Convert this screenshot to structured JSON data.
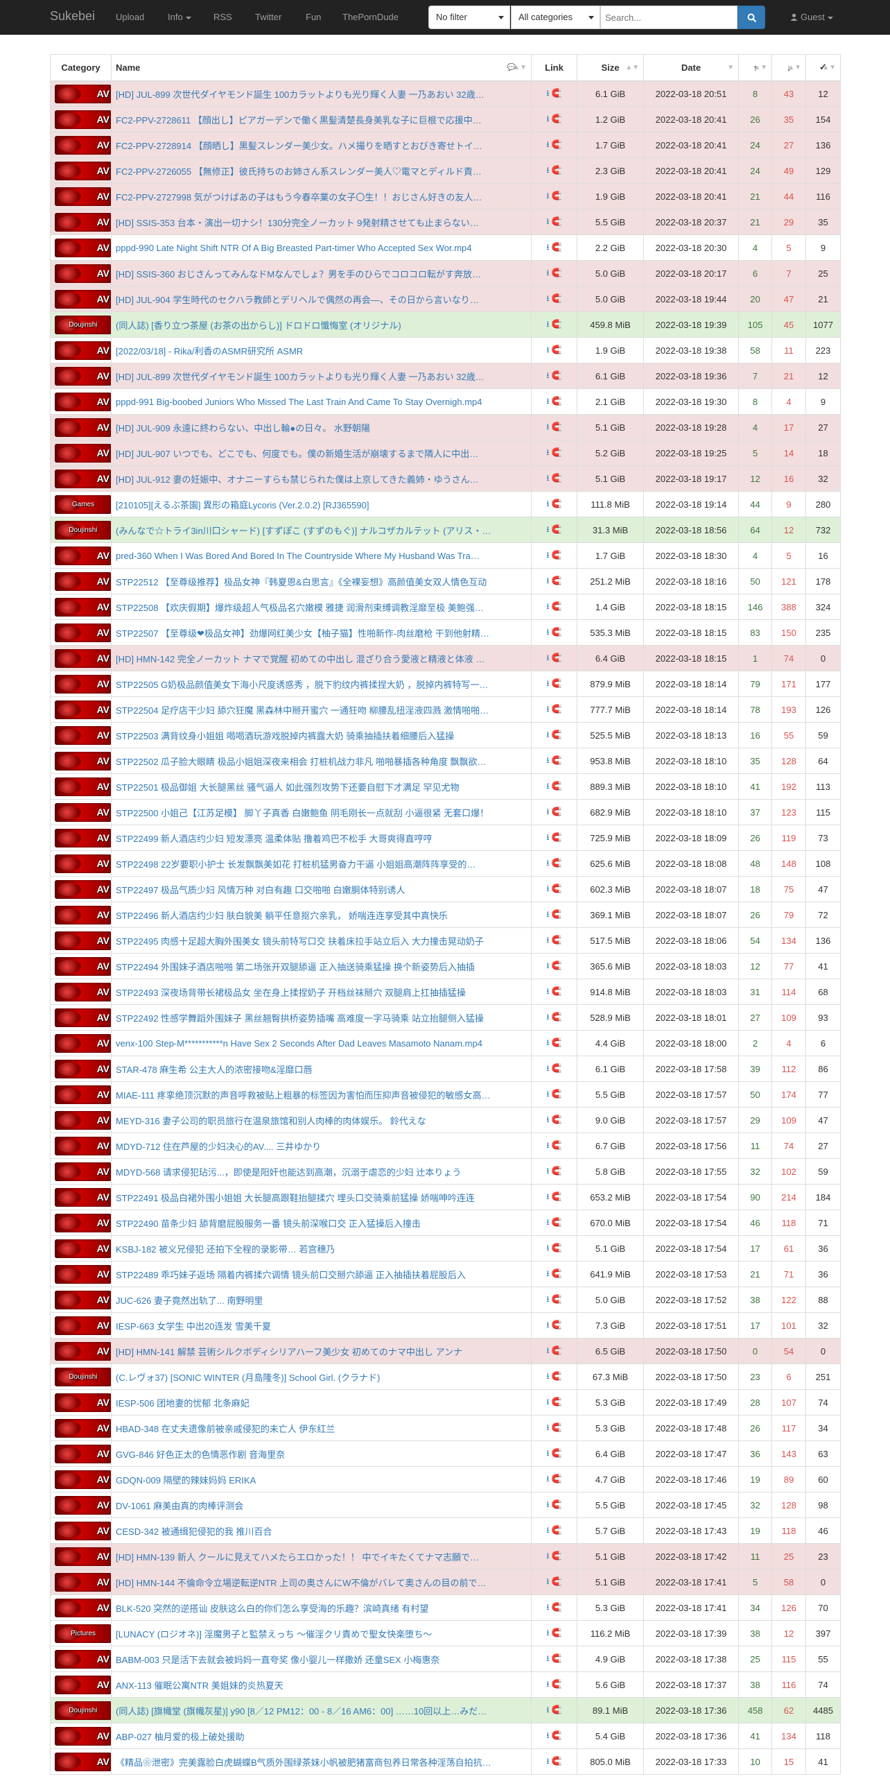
{
  "navbar": {
    "brand": "Sukebei",
    "links": [
      "Upload",
      "Info",
      "RSS",
      "Twitter",
      "Fun",
      "ThePornDude"
    ],
    "filter": "No filter",
    "category": "All categories",
    "search_placeholder": "Search...",
    "user": "Guest"
  },
  "table": {
    "headers": [
      "Category",
      "Name",
      "Link",
      "Size",
      "Date",
      "↑",
      "↓",
      "✓"
    ],
    "rows": [
      {
        "cat": "AV",
        "name": "[HD] JUL-899 次世代ダイヤモンド誕生 100カラットよりも光り輝く人妻 一乃あおい 32歳…",
        "size": "6.1 GiB",
        "date": "2022-03-18 20:51",
        "seed": "8",
        "leech": "43",
        "dl": "12",
        "style": "danger"
      },
      {
        "cat": "AV",
        "name": "FC2-PPV-2728611 【顔出し】ピアガーデンで働く黒髪清楚長身美乳な子に巨根で応援中…",
        "size": "1.2 GiB",
        "date": "2022-03-18 20:41",
        "seed": "26",
        "leech": "35",
        "dl": "154",
        "style": "danger"
      },
      {
        "cat": "AV",
        "name": "FC2-PPV-2728914 【顔晒し】黒髪スレンダー美少女。ハメ撮りを晒すとおびき寄せトイ…",
        "size": "1.7 GiB",
        "date": "2022-03-18 20:41",
        "seed": "24",
        "leech": "27",
        "dl": "136",
        "style": "danger"
      },
      {
        "cat": "AV",
        "name": "FC2-PPV-2726055 【無修正】彼氏持ちのお姉さん系スレンダー美人♡電マとディルド責…",
        "size": "2.3 GiB",
        "date": "2022-03-18 20:41",
        "seed": "24",
        "leech": "49",
        "dl": "129",
        "style": "danger"
      },
      {
        "cat": "AV",
        "name": "FC2-PPV-2727998 気がつけばあの子はもう今春卒業の女子〇生！！おじさん好きの友人…",
        "size": "1.9 GiB",
        "date": "2022-03-18 20:41",
        "seed": "21",
        "leech": "44",
        "dl": "116",
        "style": "danger"
      },
      {
        "cat": "AV",
        "name": "[HD] SSIS-353 台本・演出一切ナシ！130分完全ノーカット 9発射精させても止まらない…",
        "size": "5.5 GiB",
        "date": "2022-03-18 20:37",
        "seed": "21",
        "leech": "29",
        "dl": "35",
        "style": "danger"
      },
      {
        "cat": "AV",
        "name": "pppd-990 Late Night Shift NTR Of A Big Breasted Part-timer Who Accepted Sex Wor.mp4",
        "size": "2.2 GiB",
        "date": "2022-03-18 20:30",
        "seed": "4",
        "leech": "5",
        "dl": "9",
        "style": ""
      },
      {
        "cat": "AV",
        "name": "[HD] SSIS-360 おじさんってみんなドMなんでしょ？男を手のひらでコロコロ転がす奔放…",
        "size": "5.0 GiB",
        "date": "2022-03-18 20:17",
        "seed": "6",
        "leech": "7",
        "dl": "25",
        "style": "danger"
      },
      {
        "cat": "AV",
        "name": "[HD] JUL-904 学生時代のセクハラ教師とデリヘルで偶然の再会—、その日から言いなり…",
        "size": "5.0 GiB",
        "date": "2022-03-18 19:44",
        "seed": "20",
        "leech": "47",
        "dl": "21",
        "style": "danger"
      },
      {
        "cat": "Doujinshi",
        "name": "(同人誌) [香り立つ茶屋 (お茶の出からし)] ドロドロ懺悔室 (オリジナル)",
        "size": "459.8 MiB",
        "date": "2022-03-18 19:39",
        "seed": "105",
        "leech": "45",
        "dl": "1077",
        "style": "success"
      },
      {
        "cat": "AV",
        "name": "[2022/03/18] - Rika/利香のASMR研究所 ASMR",
        "size": "1.9 GiB",
        "date": "2022-03-18 19:38",
        "seed": "58",
        "leech": "11",
        "dl": "223",
        "style": ""
      },
      {
        "cat": "AV",
        "name": "[HD] JUL-899 次世代ダイヤモンド誕生 100カラットよりも光り輝く人妻 一乃あおい 32歳…",
        "size": "6.1 GiB",
        "date": "2022-03-18 19:36",
        "seed": "7",
        "leech": "21",
        "dl": "12",
        "style": "danger"
      },
      {
        "cat": "AV",
        "name": "pppd-991 Big-boobed Juniors Who Missed The Last Train And Came To Stay Overnigh.mp4",
        "size": "2.1 GiB",
        "date": "2022-03-18 19:30",
        "seed": "8",
        "leech": "4",
        "dl": "9",
        "style": ""
      },
      {
        "cat": "AV",
        "name": "[HD] JUL-909 永遠に終わらない、中出し輪●の日々。 水野朝陽",
        "size": "5.1 GiB",
        "date": "2022-03-18 19:28",
        "seed": "4",
        "leech": "17",
        "dl": "27",
        "style": "danger"
      },
      {
        "cat": "AV",
        "name": "[HD] JUL-907 いつでも、どこでも、何度でも。僕の新婚生活が崩壊するまで隣人に中出…",
        "size": "5.2 GiB",
        "date": "2022-03-18 19:25",
        "seed": "5",
        "leech": "14",
        "dl": "18",
        "style": "danger"
      },
      {
        "cat": "AV",
        "name": "[HD] JUL-912 妻の妊娠中、オナニーすらも禁じられた僕は上京してきた義姉・ゆうさん…",
        "size": "5.1 GiB",
        "date": "2022-03-18 19:17",
        "seed": "12",
        "leech": "16",
        "dl": "32",
        "style": "danger"
      },
      {
        "cat": "Games",
        "name": "[210105][えるぶ茶園] 異形の箱庭Lycoris (Ver.2.0.2) [RJ365590]",
        "size": "111.8 MiB",
        "date": "2022-03-18 19:14",
        "seed": "44",
        "leech": "9",
        "dl": "280",
        "style": ""
      },
      {
        "cat": "Doujinshi",
        "name": "(みんなで☆トライ3in川口シャード) [すずぽこ (すずのもぐ)] ナルコザカルテット (アリス・…",
        "size": "31.3 MiB",
        "date": "2022-03-18 18:56",
        "seed": "64",
        "leech": "12",
        "dl": "732",
        "style": "success"
      },
      {
        "cat": "AV",
        "name": "pred-360 When I Was Bored And Bored In The Countryside Where My Husband Was Tra…",
        "size": "1.7 GiB",
        "date": "2022-03-18 18:30",
        "seed": "4",
        "leech": "5",
        "dl": "16",
        "style": ""
      },
      {
        "cat": "AV",
        "name": "STP22512 【至尊级推荐】极品女神『韩夏恩&白思言』《全裸妄想》高颜值美女双人情色互动",
        "size": "251.2 MiB",
        "date": "2022-03-18 18:16",
        "seed": "50",
        "leech": "121",
        "dl": "178",
        "style": ""
      },
      {
        "cat": "AV",
        "name": "STP22508 【欢庆假期】爆炸级超人气极品名穴嫩模 雅捷 润滑剂束缚调教淫靡至极 美鲍强…",
        "size": "1.4 GiB",
        "date": "2022-03-18 18:15",
        "seed": "146",
        "leech": "388",
        "dl": "324",
        "style": ""
      },
      {
        "cat": "AV",
        "name": "STP22507 【至尊级❤极品女神】劲爆网红美少女【柚子猫】性啪新作-肉丝磨枪 干到他射精…",
        "size": "535.3 MiB",
        "date": "2022-03-18 18:15",
        "seed": "83",
        "leech": "150",
        "dl": "235",
        "style": ""
      },
      {
        "cat": "AV",
        "name": "[HD] HMN-142 完全ノーカット ナマで覚醒 初めての中出し 混ざり合う愛液と精液と体液 …",
        "size": "6.4 GiB",
        "date": "2022-03-18 18:15",
        "seed": "1",
        "leech": "74",
        "dl": "0",
        "style": "danger"
      },
      {
        "cat": "AV",
        "name": "STP22505 G奶极品颜值美女下海小尺度诱惑秀 ，脱下豹纹内裤揉捏大奶 ，脱掉内裤特写一…",
        "size": "879.9 MiB",
        "date": "2022-03-18 18:14",
        "seed": "79",
        "leech": "171",
        "dl": "177",
        "style": ""
      },
      {
        "cat": "AV",
        "name": "STP22504 足疗店干少妇 舔穴狂魔 黑森林中掰开蜜穴 一通狂吻 柳腰乱扭淫液四溅 激情啪啪…",
        "size": "777.7 MiB",
        "date": "2022-03-18 18:14",
        "seed": "78",
        "leech": "193",
        "dl": "126",
        "style": ""
      },
      {
        "cat": "AV",
        "name": "STP22503 满背纹身小姐姐 喝喝酒玩游戏脱掉内裤露大奶 骑乘抽插扶着细腰后入猛操",
        "size": "525.5 MiB",
        "date": "2022-03-18 18:13",
        "seed": "16",
        "leech": "55",
        "dl": "59",
        "style": ""
      },
      {
        "cat": "AV",
        "name": "STP22502 瓜子脸大眼睛 极品小姐姐深夜来相会 打桩机战力非凡 啪啪暴插各种角度 飘飘欲…",
        "size": "953.8 MiB",
        "date": "2022-03-18 18:10",
        "seed": "35",
        "leech": "128",
        "dl": "64",
        "style": ""
      },
      {
        "cat": "AV",
        "name": "STP22501 极品御姐 大长腿黑丝 骚气逼人 如此强烈攻势下还要自慰下才满足 罕见尤物",
        "size": "889.3 MiB",
        "date": "2022-03-18 18:10",
        "seed": "41",
        "leech": "192",
        "dl": "113",
        "style": ""
      },
      {
        "cat": "AV",
        "name": "STP22500 小姐己【江苏足模】 脚丫子真香 白嫩鲍鱼 阴毛刚长一点就刮 小逼很紧 无套口爆！",
        "size": "682.9 MiB",
        "date": "2022-03-18 18:10",
        "seed": "37",
        "leech": "123",
        "dl": "115",
        "style": ""
      },
      {
        "cat": "AV",
        "name": "STP22499 新人酒店约少妇 短发漂亮 温柔体贴 撸着鸡巴不松手 大哥爽得直哼哼",
        "size": "725.9 MiB",
        "date": "2022-03-18 18:09",
        "seed": "26",
        "leech": "119",
        "dl": "73",
        "style": ""
      },
      {
        "cat": "AV",
        "name": "STP22498 22岁要职小护士 长发飘飘美如花 打桩机猛男奋力干逼 小姐姐高潮阵阵享受的…",
        "size": "625.6 MiB",
        "date": "2022-03-18 18:08",
        "seed": "48",
        "leech": "148",
        "dl": "108",
        "style": ""
      },
      {
        "cat": "AV",
        "name": "STP22497 极品气质少妇 风情万种 对白有趣 口交啪啪 白嫩胴体特别诱人",
        "size": "602.3 MiB",
        "date": "2022-03-18 18:07",
        "seed": "18",
        "leech": "75",
        "dl": "47",
        "style": ""
      },
      {
        "cat": "AV",
        "name": "STP22496 新人酒店约少妇 肤白貌美 躺平任意抠穴亲乳， 娇喘连连享受其中真快乐",
        "size": "369.1 MiB",
        "date": "2022-03-18 18:07",
        "seed": "26",
        "leech": "79",
        "dl": "72",
        "style": ""
      },
      {
        "cat": "AV",
        "name": "STP22495 肉感十足超大胸外围美女 镜头前特写口交 扶着床拉手站立后入 大力撞击晃动奶子",
        "size": "517.5 MiB",
        "date": "2022-03-18 18:06",
        "seed": "54",
        "leech": "134",
        "dl": "136",
        "style": ""
      },
      {
        "cat": "AV",
        "name": "STP22494 外围妹子酒店啪啪 第二场张开双腿舔逼 正入抽送骑乘猛操 换个新姿势后入抽插",
        "size": "365.6 MiB",
        "date": "2022-03-18 18:03",
        "seed": "12",
        "leech": "77",
        "dl": "41",
        "style": ""
      },
      {
        "cat": "AV",
        "name": "STP22493 深夜场背带长裙极品女 坐在身上揉捏奶子 开档丝袜掰穴 双腿肩上扛抽插猛操",
        "size": "914.8 MiB",
        "date": "2022-03-18 18:03",
        "seed": "31",
        "leech": "114",
        "dl": "68",
        "style": ""
      },
      {
        "cat": "AV",
        "name": "STP22492 性感学舞蹈外围妹子 黑丝翘臀拱桥姿势插嘴 高难度一字马骑乘 站立抬腿侧入猛操",
        "size": "528.9 MiB",
        "date": "2022-03-18 18:01",
        "seed": "27",
        "leech": "109",
        "dl": "93",
        "style": ""
      },
      {
        "cat": "AV",
        "name": "venx-100 Step-M***********n Have Sex 2 Seconds After Dad Leaves Masamoto Nanam.mp4",
        "size": "4.4 GiB",
        "date": "2022-03-18 18:00",
        "seed": "2",
        "leech": "4",
        "dl": "6",
        "style": ""
      },
      {
        "cat": "AV",
        "name": "STAR-478 麻生希 公主大人的浓密接吻&淫靡口唇",
        "size": "6.1 GiB",
        "date": "2022-03-18 17:58",
        "seed": "39",
        "leech": "112",
        "dl": "86",
        "style": ""
      },
      {
        "cat": "AV",
        "name": "MIAE-111 疼挛绝顶沉默的声音呼救被贴上粗暴的标签因为害怕而压抑声音被侵犯的敏感女高…",
        "size": "5.5 GiB",
        "date": "2022-03-18 17:57",
        "seed": "50",
        "leech": "174",
        "dl": "77",
        "style": ""
      },
      {
        "cat": "AV",
        "name": "MEYD-316 妻子公司的职员旅行在温泉旅馆和别人肉棒的肉体娱乐。 鈴代えな",
        "size": "9.0 GiB",
        "date": "2022-03-18 17:57",
        "seed": "29",
        "leech": "109",
        "dl": "47",
        "style": ""
      },
      {
        "cat": "AV",
        "name": "MDYD-712 住在芦屋的少妇决心的AV.... 三井ゆかり",
        "size": "6.7 GiB",
        "date": "2022-03-18 17:56",
        "seed": "11",
        "leech": "74",
        "dl": "27",
        "style": ""
      },
      {
        "cat": "AV",
        "name": "MDYD-568 请求侵犯玷污...，即使是阳奸也能达到高潮，沉溺于虐恋的少妇 辻本りょう",
        "size": "5.8 GiB",
        "date": "2022-03-18 17:55",
        "seed": "32",
        "leech": "102",
        "dl": "59",
        "style": ""
      },
      {
        "cat": "AV",
        "name": "STP22491 极品白裙外围小姐姐 大长腿高跟鞋抬腿揉穴 埋头口交骑乘前猛操 娇喘呻吟连连",
        "size": "653.2 MiB",
        "date": "2022-03-18 17:54",
        "seed": "90",
        "leech": "214",
        "dl": "184",
        "style": ""
      },
      {
        "cat": "AV",
        "name": "STP22490 苗条少妇 舔背磨屁股服务一番 镜头前深喉口交 正入猛操后入撞击",
        "size": "670.0 MiB",
        "date": "2022-03-18 17:54",
        "seed": "46",
        "leech": "118",
        "dl": "71",
        "style": ""
      },
      {
        "cat": "AV",
        "name": "KSBJ-182 被义兄侵犯 还拍下全程的录影带… 若宫穗乃",
        "size": "5.1 GiB",
        "date": "2022-03-18 17:54",
        "seed": "17",
        "leech": "61",
        "dl": "36",
        "style": ""
      },
      {
        "cat": "AV",
        "name": "STP22489 乖巧妹子返场 隔着内裤揉穴调情 镜头前口交掰穴舔逼 正入抽插扶着屁股后入",
        "size": "641.9 MiB",
        "date": "2022-03-18 17:53",
        "seed": "21",
        "leech": "71",
        "dl": "36",
        "style": ""
      },
      {
        "cat": "AV",
        "name": "JUC-626 妻子竟然出轨了... 南野明里",
        "size": "5.0 GiB",
        "date": "2022-03-18 17:52",
        "seed": "38",
        "leech": "122",
        "dl": "88",
        "style": ""
      },
      {
        "cat": "AV",
        "name": "IESP-663 女学生 中出20连发 雪美千夏",
        "size": "7.3 GiB",
        "date": "2022-03-18 17:51",
        "seed": "17",
        "leech": "101",
        "dl": "32",
        "style": ""
      },
      {
        "cat": "AV",
        "name": "[HD] HMN-141 解禁 芸術シルクボディシリアハーフ美少女 初めてのナマ中出し アンナ",
        "size": "6.5 GiB",
        "date": "2022-03-18 17:50",
        "seed": "0",
        "leech": "54",
        "dl": "0",
        "style": "danger"
      },
      {
        "cat": "Doujinshi",
        "name": "(C.レヴォ37) [SONIC WINTER (月島隆冬)] School Girl. (クラナド)",
        "size": "67.3 MiB",
        "date": "2022-03-18 17:50",
        "seed": "23",
        "leech": "6",
        "dl": "251",
        "style": ""
      },
      {
        "cat": "AV",
        "name": "IESP-506 团地妻的忧郁 北条麻妃",
        "size": "5.3 GiB",
        "date": "2022-03-18 17:49",
        "seed": "28",
        "leech": "107",
        "dl": "74",
        "style": ""
      },
      {
        "cat": "AV",
        "name": "HBAD-348 在丈夫遗像前被亲戚侵犯的未亡人 伊东红兰",
        "size": "5.3 GiB",
        "date": "2022-03-18 17:48",
        "seed": "26",
        "leech": "117",
        "dl": "34",
        "style": ""
      },
      {
        "cat": "AV",
        "name": "GVG-846 好色正太的色情恶作剧 音海里奈",
        "size": "6.4 GiB",
        "date": "2022-03-18 17:47",
        "seed": "36",
        "leech": "143",
        "dl": "63",
        "style": ""
      },
      {
        "cat": "AV",
        "name": "GDQN-009 隔壁的辣妹妈妈 ERIKA",
        "size": "4.7 GiB",
        "date": "2022-03-18 17:46",
        "seed": "19",
        "leech": "89",
        "dl": "60",
        "style": ""
      },
      {
        "cat": "AV",
        "name": "DV-1061 麻美由真的肉棒评测会",
        "size": "5.5 GiB",
        "date": "2022-03-18 17:45",
        "seed": "32",
        "leech": "128",
        "dl": "98",
        "style": ""
      },
      {
        "cat": "AV",
        "name": "CESD-342 被通缉犯侵犯的我 推川百合",
        "size": "5.7 GiB",
        "date": "2022-03-18 17:43",
        "seed": "19",
        "leech": "118",
        "dl": "46",
        "style": ""
      },
      {
        "cat": "AV",
        "name": "[HD] HMN-139 新人 クールに見えてハメたらエロかった！！ 中でイキたくてナマ志願で…",
        "size": "5.1 GiB",
        "date": "2022-03-18 17:42",
        "seed": "11",
        "leech": "25",
        "dl": "23",
        "style": "danger"
      },
      {
        "cat": "AV",
        "name": "[HD] HMN-144 不倫命令立場逆転逆NTR 上司の奥さんにW不倫がバレて奥さんの目の前で…",
        "size": "5.1 GiB",
        "date": "2022-03-18 17:41",
        "seed": "5",
        "leech": "58",
        "dl": "0",
        "style": "danger"
      },
      {
        "cat": "AV",
        "name": "BLK-520 突然的逆搭讪 皮肤这么白的你们怎么享受海的乐趣？滨崎真绪 有村望",
        "size": "5.3 GiB",
        "date": "2022-03-18 17:41",
        "seed": "34",
        "leech": "126",
        "dl": "70",
        "style": ""
      },
      {
        "cat": "Pictures",
        "name": "[LUNACY (ロジオネ)] 淫魔男子と監禁えっち ～催淫クリ責めで聖女快楽堕ち～",
        "size": "116.2 MiB",
        "date": "2022-03-18 17:39",
        "seed": "38",
        "leech": "12",
        "dl": "397",
        "style": ""
      },
      {
        "cat": "AV",
        "name": "BABM-003 只是活下去就会被妈妈一直夸奖 像小婴儿一样撒娇 还童SEX 小梅惠奈",
        "size": "4.9 GiB",
        "date": "2022-03-18 17:38",
        "seed": "25",
        "leech": "115",
        "dl": "55",
        "style": ""
      },
      {
        "cat": "AV",
        "name": "ANX-113 催眠公寓NTR 美姐妹的炎热夏天",
        "size": "5.6 GiB",
        "date": "2022-03-18 17:37",
        "seed": "38",
        "leech": "116",
        "dl": "74",
        "style": ""
      },
      {
        "cat": "Doujinshi",
        "name": "(同人誌) [旗幟堂 (旗幟灰星)] y90 [8／12 PM12：00 - 8／16 AM6：00] ……10回以上…みだ…",
        "size": "89.1 MiB",
        "date": "2022-03-18 17:36",
        "seed": "458",
        "leech": "62",
        "dl": "4485",
        "style": "success"
      },
      {
        "cat": "AV",
        "name": "ABP-027 柚月爱的极上破处援助",
        "size": "5.4 GiB",
        "date": "2022-03-18 17:36",
        "seed": "41",
        "leech": "134",
        "dl": "118",
        "style": ""
      },
      {
        "cat": "AV",
        "name": "《精品❀泄密》完美露脸白虎蝴蝶B气质外围绿茶妹小帆被肥猪富商包养日常各种淫荡自拍抗…",
        "size": "805.0 MiB",
        "date": "2022-03-18 17:33",
        "seed": "10",
        "leech": "15",
        "dl": "41",
        "style": ""
      }
    ]
  }
}
